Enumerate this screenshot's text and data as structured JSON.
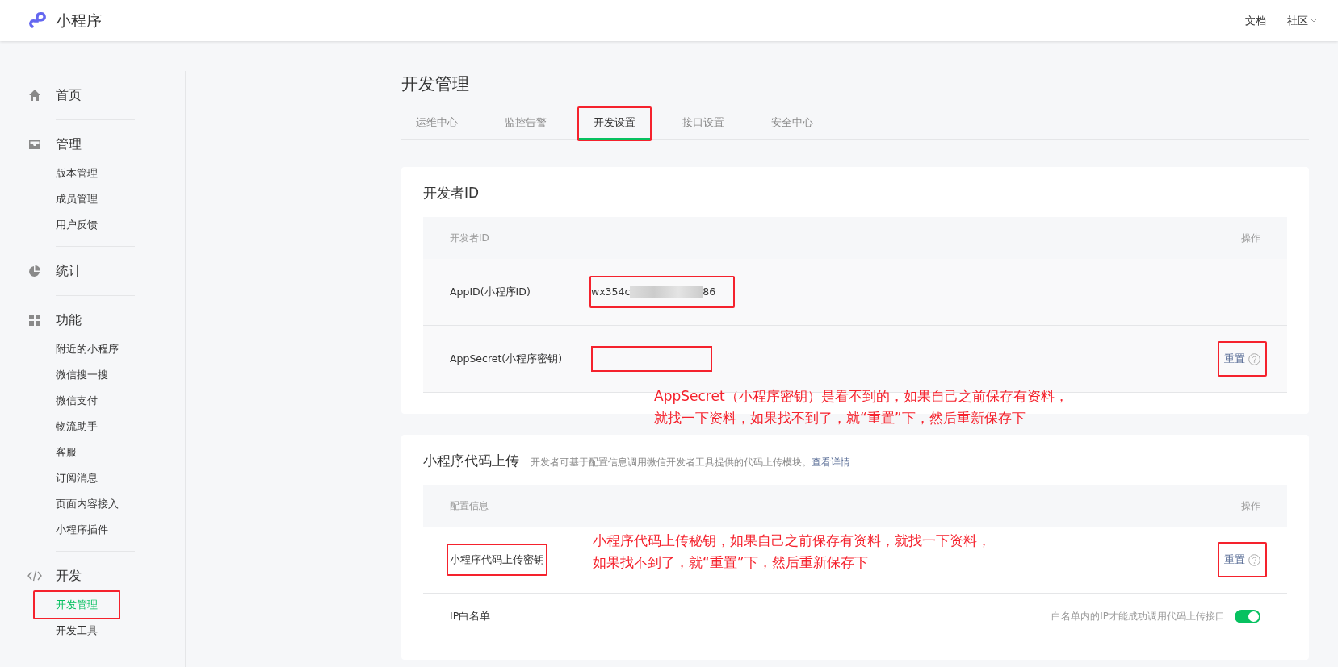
{
  "header": {
    "logo_text": "小程序",
    "links": [
      {
        "label": "文档",
        "dropdown": false
      },
      {
        "label": "社区",
        "dropdown": true
      }
    ]
  },
  "sidebar": {
    "groups": [
      {
        "kind": "home",
        "label": "首页"
      },
      {
        "kind": "inbox",
        "label": "管理",
        "children": [
          {
            "label": "版本管理",
            "selected": false,
            "highlighted": false
          },
          {
            "label": "成员管理",
            "selected": false,
            "highlighted": false
          },
          {
            "label": "用户反馈",
            "selected": false,
            "highlighted": false
          }
        ]
      },
      {
        "kind": "pie",
        "label": "统计"
      },
      {
        "kind": "grid",
        "label": "功能",
        "children": [
          {
            "label": "附近的小程序",
            "selected": false,
            "highlighted": false
          },
          {
            "label": "微信搜一搜",
            "selected": false,
            "highlighted": false
          },
          {
            "label": "微信支付",
            "selected": false,
            "highlighted": false
          },
          {
            "label": "物流助手",
            "selected": false,
            "highlighted": false
          },
          {
            "label": "客服",
            "selected": false,
            "highlighted": false
          },
          {
            "label": "订阅消息",
            "selected": false,
            "highlighted": false
          },
          {
            "label": "页面内容接入",
            "selected": false,
            "highlighted": false
          },
          {
            "label": "小程序插件",
            "selected": false,
            "highlighted": false
          }
        ]
      },
      {
        "kind": "code",
        "label": "开发",
        "children": [
          {
            "label": "开发管理",
            "selected": true,
            "highlighted": true
          },
          {
            "label": "开发工具",
            "selected": false,
            "highlighted": false
          }
        ]
      }
    ]
  },
  "page_title": "开发管理",
  "tabs": [
    {
      "label": "运维中心",
      "selected": false,
      "highlighted": false
    },
    {
      "label": "监控告警",
      "selected": false,
      "highlighted": false
    },
    {
      "label": "开发设置",
      "selected": true,
      "highlighted": true
    },
    {
      "label": "接口设置",
      "selected": false,
      "highlighted": false
    },
    {
      "label": "安全中心",
      "selected": false,
      "highlighted": false
    }
  ],
  "cards": [
    {
      "title": "开发者ID",
      "columns": [
        "开发者ID",
        "操作"
      ],
      "rows": [
        {
          "kind": "value",
          "label": "AppID(小程序ID)",
          "label_highlighted": false,
          "value_start": "wx354c",
          "value_end": "86",
          "redacted": true,
          "value_highlighted": true
        },
        {
          "kind": "action",
          "label": "AppSecret(小程序密钥)",
          "label_highlighted": false,
          "value_highlighted": true,
          "action": "重置",
          "action_highlighted": true
        }
      ],
      "annotation": [
        "AppSecret（小程序密钥）是看不到的，如果自己之前保存有资料，",
        "就找一下资料，如果找不到了，就“重置”下，然后重新保存下"
      ]
    },
    {
      "title": "小程序代码上传",
      "description": "开发者可基于配置信息调用微信开发者工具提供的代码上传模块。",
      "link": "查看详情",
      "columns": [
        "配置信息",
        "操作"
      ],
      "rows": [
        {
          "kind": "action",
          "label": "小程序代码上传密钥",
          "label_highlighted": true,
          "value_highlighted": false,
          "action": "重置",
          "action_highlighted": true,
          "annotation": [
            "小程序代码上传秘钥，如果自己之前保存有资料，就找一下资料，",
            "如果找不到了，就“重置”下，然后重新保存下"
          ]
        },
        {
          "kind": "toggle",
          "label": "IP白名单",
          "label_highlighted": false,
          "hint": "白名单内的IP才能成功调用代码上传接口",
          "on": true
        }
      ]
    }
  ]
}
